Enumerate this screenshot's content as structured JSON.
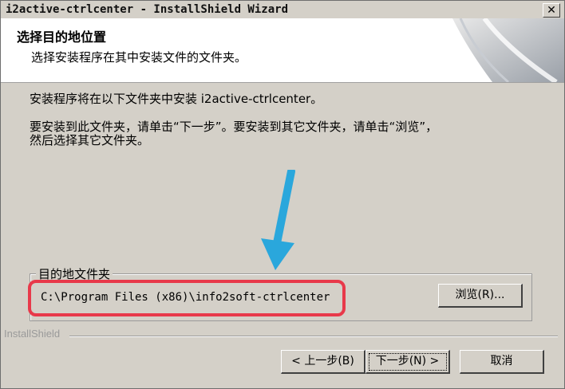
{
  "window": {
    "title": "i2active-ctrlcenter - InstallShield Wizard",
    "close_label": "✕"
  },
  "header": {
    "title": "选择目的地位置",
    "subtitle": "选择安装程序在其中安装文件的文件夹。"
  },
  "body": {
    "line1": "安装程序将在以下文件夹中安装 i2active-ctrlcenter。",
    "line2": "要安装到此文件夹，请单击“下一步”。要安装到其它文件夹，请单击“浏览”，",
    "line3": "然后选择其它文件夹。"
  },
  "destination": {
    "group_label": "目的地文件夹",
    "path": "C:\\Program Files (x86)\\info2soft-ctrlcenter",
    "browse_label": "浏览(R)..."
  },
  "footer": {
    "brand": "InstallShield",
    "back_label": "< 上一步(B)",
    "next_label": "下一步(N) >",
    "cancel_label": "取消"
  },
  "colors": {
    "highlight": "#e8394a",
    "arrow": "#2aa7dc",
    "dialog_bg": "#d4d0c8"
  },
  "icons": {
    "close": "close-icon",
    "arrow": "annotation-arrow-icon"
  }
}
